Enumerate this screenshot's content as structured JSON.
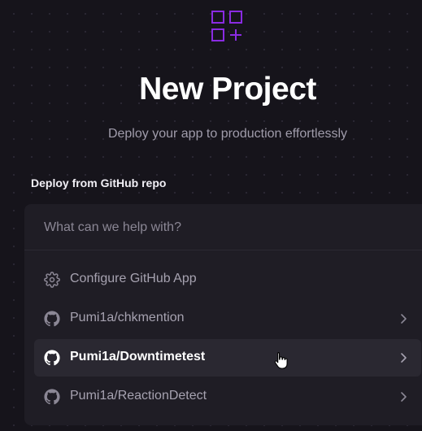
{
  "header": {
    "logo_icon": "grid-plus-icon",
    "title": "New Project",
    "subtitle": "Deploy your app to production effortlessly"
  },
  "section": {
    "label": "Deploy from GitHub repo"
  },
  "search": {
    "placeholder": "What can we help with?",
    "value": ""
  },
  "items": [
    {
      "label": "Configure GitHub App",
      "icon": "gear-icon",
      "chevron": false
    },
    {
      "label": "Pumi1a/chkmention",
      "icon": "github-icon",
      "chevron": true
    },
    {
      "label": "Pumi1a/Downtimetest",
      "icon": "github-icon",
      "chevron": true,
      "highlighted": true
    },
    {
      "label": "Pumi1a/ReactionDetect",
      "icon": "github-icon",
      "chevron": true
    }
  ],
  "colors": {
    "accent": "#8a2be2",
    "background": "#16141b",
    "panel": "#1f1d25",
    "highlight_row": "#2a2831"
  }
}
